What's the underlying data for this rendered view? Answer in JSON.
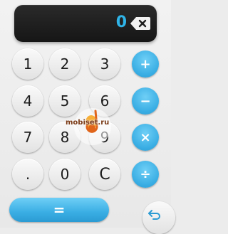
{
  "display": {
    "value": "0"
  },
  "keys": {
    "k1": "1",
    "k2": "2",
    "k3": "3",
    "k4": "4",
    "k5": "5",
    "k6": "6",
    "k7": "7",
    "k8": "8",
    "k9": "9",
    "dot": ".",
    "k0": "0",
    "clear": "C"
  },
  "operators": {
    "add": "+",
    "subtract": "−",
    "multiply": "×",
    "divide": "÷"
  },
  "equals_label": "=",
  "watermark": {
    "text": "mobiset.ru"
  },
  "colors": {
    "accent": "#3aaee4",
    "display_bg": "#1c1c1c",
    "display_text": "#2fb4e8"
  },
  "icons": {
    "backspace": "backspace-icon",
    "back": "back-arrow-icon"
  }
}
